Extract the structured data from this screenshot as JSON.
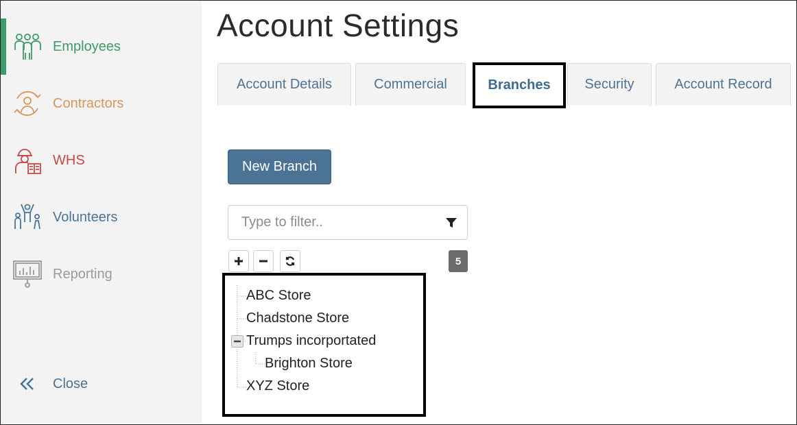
{
  "sidebar": {
    "items": [
      {
        "label": "Employees",
        "color": "#3d9a6b",
        "icon": "people-group-icon",
        "active": true
      },
      {
        "label": "Contractors",
        "color": "#d8975a",
        "icon": "contractor-cycle-icon"
      },
      {
        "label": "WHS",
        "color": "#c84848",
        "icon": "worker-safety-icon"
      },
      {
        "label": "Volunteers",
        "color": "#4a7396",
        "icon": "volunteers-icon"
      },
      {
        "label": "Reporting",
        "color": "#9a9a9a",
        "icon": "presentation-chart-icon"
      }
    ],
    "close_label": "Close"
  },
  "page": {
    "title": "Account Settings"
  },
  "tabs": [
    {
      "label": "Account Details"
    },
    {
      "label": "Commercial"
    },
    {
      "label": "Branches",
      "active": true
    },
    {
      "label": "Security"
    },
    {
      "label": "Account Record"
    }
  ],
  "actions": {
    "new_branch_label": "New Branch"
  },
  "filter": {
    "placeholder": "Type to filter..",
    "value": ""
  },
  "tree_toolbar": {
    "expand_icon": "plus-icon",
    "collapse_icon": "minus-icon",
    "refresh_icon": "refresh-icon",
    "count": "5"
  },
  "tree": {
    "nodes": [
      {
        "label": "ABC Store"
      },
      {
        "label": "Chadstone Store"
      },
      {
        "label": "Trumps incorportated",
        "expanded": true
      },
      {
        "label": "Brighton Store"
      },
      {
        "label": "XYZ Store"
      }
    ]
  }
}
